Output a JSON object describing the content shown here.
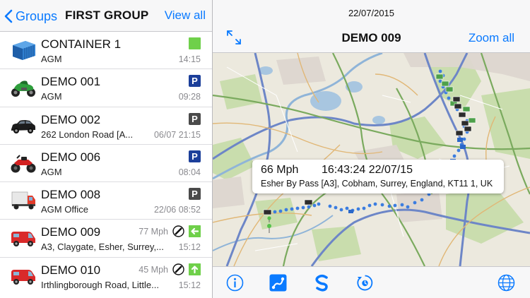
{
  "left": {
    "back_label": "Groups",
    "group_title": "FIRST GROUP",
    "view_all": "View all"
  },
  "vehicles": [
    {
      "name": "CONTAINER 1",
      "address": "AGM",
      "time": "14:15",
      "status": "green-square",
      "icon": "container-icon"
    },
    {
      "name": "DEMO 001",
      "address": "AGM",
      "time": "09:28",
      "status": "parked-blue",
      "status_label": "P",
      "icon": "motorbike-icon"
    },
    {
      "name": "DEMO 002",
      "address": "262 London Road [A...",
      "time": "06/07 21:15",
      "status": "parked-grey",
      "status_label": "P",
      "icon": "car-icon"
    },
    {
      "name": "DEMO 006",
      "address": "AGM",
      "time": "08:04",
      "status": "parked-blue",
      "status_label": "P",
      "icon": "quad-bike-icon"
    },
    {
      "name": "DEMO 008",
      "address": "AGM Office",
      "time": "22/06 08:52",
      "status": "parked-grey",
      "status_label": "P",
      "icon": "truck-icon"
    },
    {
      "name": "DEMO 009",
      "address": "A3, Claygate, Esher, Surrey,...",
      "time": "15:12",
      "speed": "77 Mph",
      "status": "moving-left",
      "icon": "van-icon"
    },
    {
      "name": "DEMO 010",
      "address": "Irthlingborough Road, Little...",
      "time": "15:12",
      "speed": "45 Mph",
      "status": "moving-up",
      "icon": "van-icon"
    }
  ],
  "right": {
    "date": "22/07/2015",
    "vehicle_title": "DEMO 009",
    "zoom_all": "Zoom all"
  },
  "callout": {
    "speed": "66 Mph",
    "datetime": "16:43:24 22/07/15",
    "address": "Esher By Pass [A3], Cobham, Surrey, England, KT11 1, UK"
  },
  "toolbar": [
    "info-icon",
    "route-icon",
    "replay-icon",
    "history-icon",
    "globe-icon"
  ],
  "colors": {
    "accent": "#0a7aff",
    "parked_blue": "#1c3f9a",
    "parked_grey": "#4a4a4a",
    "active_green": "#6fd04a"
  }
}
